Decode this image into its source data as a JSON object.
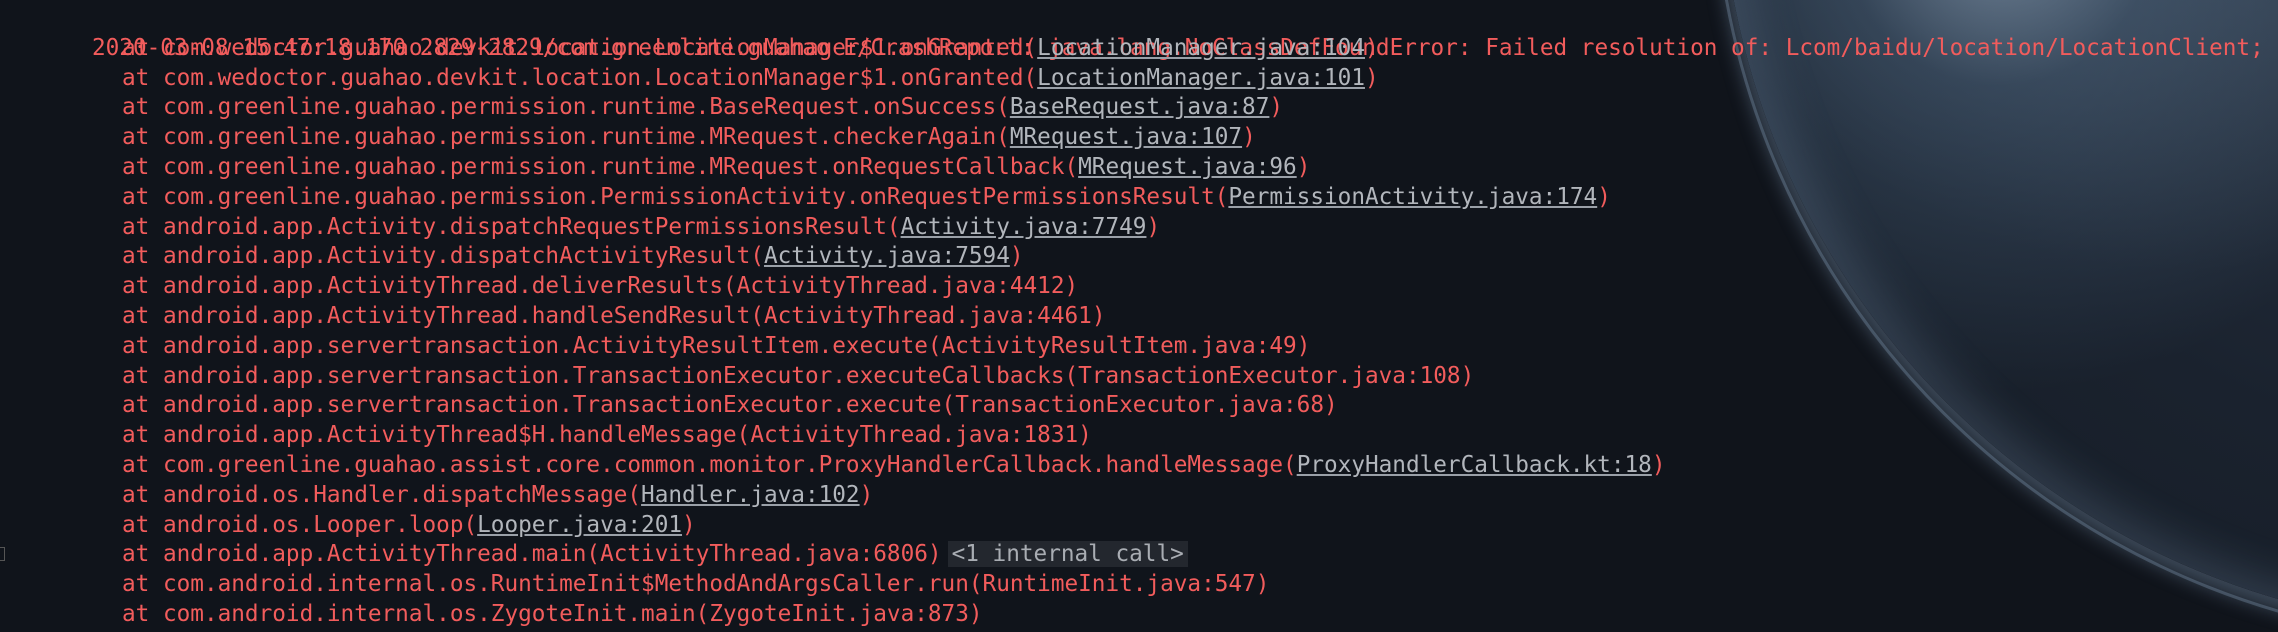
{
  "log": {
    "header": "2020-03-08 15:47:18.170 2829-2829/com.greenline.guahao E/CrashReport: java.lang.NoClassDefFoundError: Failed resolution of: Lcom/baidu/location/LocationClient;",
    "frames": [
      {
        "prefix": "at com.wedoctor.guahao.devkit.location.LocationManager$1.onGranted(",
        "source": "LocationManager.java:104",
        "linked": true
      },
      {
        "prefix": "at com.wedoctor.guahao.devkit.location.LocationManager$1.onGranted(",
        "source": "LocationManager.java:101",
        "linked": true
      },
      {
        "prefix": "at com.greenline.guahao.permission.runtime.BaseRequest.onSuccess(",
        "source": "BaseRequest.java:87",
        "linked": true
      },
      {
        "prefix": "at com.greenline.guahao.permission.runtime.MRequest.checkerAgain(",
        "source": "MRequest.java:107",
        "linked": true
      },
      {
        "prefix": "at com.greenline.guahao.permission.runtime.MRequest.onRequestCallback(",
        "source": "MRequest.java:96",
        "linked": true
      },
      {
        "prefix": "at com.greenline.guahao.permission.PermissionActivity.onRequestPermissionsResult(",
        "source": "PermissionActivity.java:174",
        "linked": true
      },
      {
        "prefix": "at android.app.Activity.dispatchRequestPermissionsResult(",
        "source": "Activity.java:7749",
        "linked": true
      },
      {
        "prefix": "at android.app.Activity.dispatchActivityResult(",
        "source": "Activity.java:7594",
        "linked": true
      },
      {
        "prefix": "at android.app.ActivityThread.deliverResults(",
        "source": "ActivityThread.java:4412",
        "linked": false
      },
      {
        "prefix": "at android.app.ActivityThread.handleSendResult(",
        "source": "ActivityThread.java:4461",
        "linked": false
      },
      {
        "prefix": "at android.app.servertransaction.ActivityResultItem.execute(",
        "source": "ActivityResultItem.java:49",
        "linked": false
      },
      {
        "prefix": "at android.app.servertransaction.TransactionExecutor.executeCallbacks(",
        "source": "TransactionExecutor.java:108",
        "linked": false
      },
      {
        "prefix": "at android.app.servertransaction.TransactionExecutor.execute(",
        "source": "TransactionExecutor.java:68",
        "linked": false
      },
      {
        "prefix": "at android.app.ActivityThread$H.handleMessage(",
        "source": "ActivityThread.java:1831",
        "linked": false
      },
      {
        "prefix": "at com.greenline.guahao.assist.core.common.monitor.ProxyHandlerCallback.handleMessage(",
        "source": "ProxyHandlerCallback.kt:18",
        "linked": true
      },
      {
        "prefix": "at android.os.Handler.dispatchMessage(",
        "source": "Handler.java:102",
        "linked": true
      },
      {
        "prefix": "at android.os.Looper.loop(",
        "source": "Looper.java:201",
        "linked": true
      },
      {
        "prefix": "at android.app.ActivityThread.main(",
        "source": "ActivityThread.java:6806",
        "linked": false,
        "internal": "<1 internal call>"
      },
      {
        "prefix": "at com.android.internal.os.RuntimeInit$MethodAndArgsCaller.run(",
        "source": "RuntimeInit.java:547",
        "linked": false
      },
      {
        "prefix": "at com.android.internal.os.ZygoteInit.main(",
        "source": "ZygoteInit.java:873",
        "linked": false
      }
    ]
  },
  "colors": {
    "error_text": "#f25c5c",
    "link_text": "#b2b6bc",
    "background": "#10141b"
  }
}
